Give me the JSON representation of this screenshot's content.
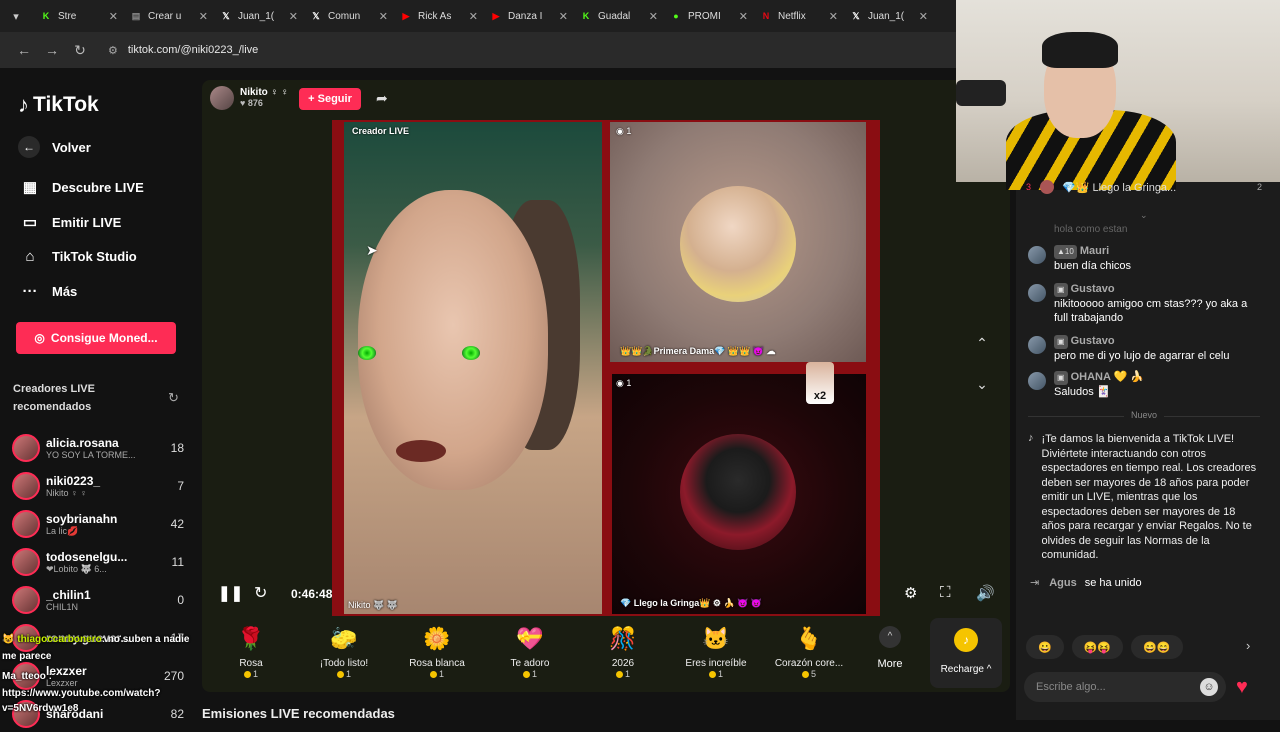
{
  "browser": {
    "tabs": [
      {
        "title": "Stre",
        "icon": "K",
        "color": "#53fc18"
      },
      {
        "title": "Crear u",
        "icon": "▤",
        "color": "#888"
      },
      {
        "title": "Juan_1(",
        "icon": "𝕏",
        "color": "#fff"
      },
      {
        "title": "Comun",
        "icon": "𝕏",
        "color": "#fff"
      },
      {
        "title": "Rick As",
        "icon": "▶",
        "color": "#ff0000"
      },
      {
        "title": "Danza I",
        "icon": "▶",
        "color": "#ff0000"
      },
      {
        "title": "Guadal",
        "icon": "K",
        "color": "#53fc18"
      },
      {
        "title": "PROMI",
        "icon": "●",
        "color": "#53fc18"
      },
      {
        "title": "Netflix",
        "icon": "N",
        "color": "#e50914"
      },
      {
        "title": "Juan_1(",
        "icon": "𝕏",
        "color": "#fff"
      }
    ],
    "url": "tiktok.com/@niki0223_/live"
  },
  "sidebar": {
    "logo": "TikTok",
    "back_label": "Volver",
    "nav": [
      {
        "label": "Descubre LIVE",
        "icon": "▦"
      },
      {
        "label": "Emitir LIVE",
        "icon": "▭"
      },
      {
        "label": "TikTok Studio",
        "icon": "⌂"
      },
      {
        "label": "Más",
        "icon": "···"
      }
    ],
    "coins_label": "Consigue Moned...",
    "recommended_title": "Creadores LIVE recomendados",
    "creators": [
      {
        "name": "alicia.rosana",
        "sub": "YO SOY LA TORME...",
        "count": "18"
      },
      {
        "name": "niki0223_",
        "sub": "Nikito ♀ ♀",
        "count": "7"
      },
      {
        "name": "soybrianahn",
        "sub": "La lic💋",
        "count": "42"
      },
      {
        "name": "todosenelgu...",
        "sub": "❤Lobito 🐺 6...",
        "count": "11"
      },
      {
        "name": "_chilin1",
        "sub": "CHIL1N",
        "count": "0"
      },
      {
        "name": "ronny.guevar...",
        "sub": "",
        "count": "17"
      },
      {
        "name": "lexzxer",
        "sub": "Lexzxer",
        "count": "270"
      },
      {
        "name": "sharodani",
        "sub": "",
        "count": "82"
      }
    ]
  },
  "overlay_chat": [
    {
      "user": "thiagoccarbonero",
      "text": ": no suben a nadie"
    },
    {
      "user": "",
      "text": "me parece"
    },
    {
      "user": "",
      "text": "Ma_tteoo :"
    },
    {
      "user": "",
      "text": "https://www.youtube.com/watch?"
    },
    {
      "user": "",
      "text": "v=5NV6rdvw1e8"
    }
  ],
  "host": {
    "name": "Nikito ♀ ♀",
    "likes": "♥ 876",
    "follow_label": "+ Seguir"
  },
  "stream": {
    "creator_label": "Creador LIVE",
    "host_tag": "Nikito 🐺 🐺",
    "guest1_viewers": "◉ 1",
    "guest1_tag": "👑👑🐊Primera Dama💎 👑👑 😈 ☁",
    "guest2_viewers": "◉ 1",
    "guest2_tag": "💎 Llego la Gringa👑 ⚙ 🍌 😈 😈",
    "multiplier": "x2",
    "timer": "0:46:48"
  },
  "gifts": [
    {
      "name": "Rosa",
      "icon": "🌹",
      "price": "1"
    },
    {
      "name": "¡Todo listo!",
      "icon": "🧽",
      "price": "1"
    },
    {
      "name": "Rosa blanca",
      "icon": "🌼",
      "price": "1"
    },
    {
      "name": "Te adoro",
      "icon": "💝",
      "price": "1"
    },
    {
      "name": "2026",
      "icon": "🎊",
      "price": "1"
    },
    {
      "name": "Eres increíble",
      "icon": "🐱",
      "price": "1"
    },
    {
      "name": "Corazón core...",
      "icon": "🫰",
      "price": "5"
    }
  ],
  "more_label": "More",
  "recharge_label": "Recharge ^",
  "section_title": "Emisiones LIVE recomendadas",
  "chat": {
    "pinned": {
      "rank": "3",
      "text": "💎👑 Llego la Gringa...",
      "count": "2"
    },
    "faded": "hola como estan",
    "messages": [
      {
        "user": "Mauri",
        "badge": "▲10",
        "text": "buen día chicos"
      },
      {
        "user": "Gustavo",
        "badge": "▣",
        "text": "nikitooooo amigoo cm stas??? yo aka a full trabajando"
      },
      {
        "user": "Gustavo",
        "badge": "▣",
        "text": "pero me di yo lujo de agarrar el celu"
      },
      {
        "user": "OHANA 💛 🍌",
        "badge": "▣",
        "text": "Saludos 🃏"
      }
    ],
    "new_label": "Nuevo",
    "welcome": "¡Te damos la bienvenida a TikTok LIVE! Diviértete interactuando con otros espectadores en tiempo real. Los creadores deben ser mayores de 18 años para poder emitir un LIVE, mientras que los espectadores deben ser mayores de 18 años para recargar y enviar Regalos. No te olvides de seguir las Normas de la comunidad.",
    "joined_user": "Agus",
    "joined_text": "se ha unido",
    "reactions": [
      "😀",
      "😝😝",
      "😄😄"
    ],
    "input_placeholder": "Escribe algo..."
  }
}
